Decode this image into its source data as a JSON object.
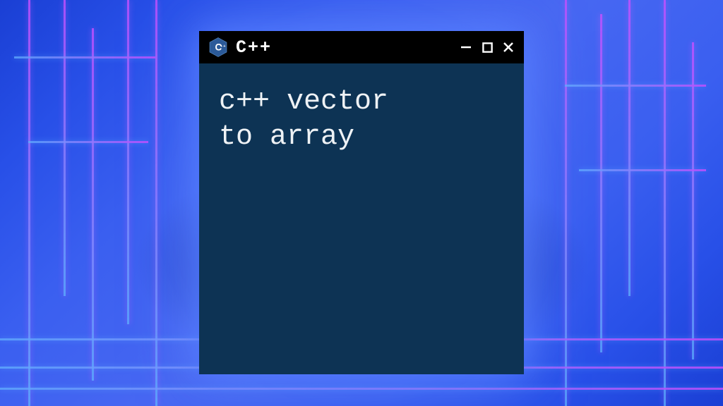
{
  "window": {
    "title": "C++",
    "logo_label": "C++",
    "content_line1": "c++ vector",
    "content_line2": "to array"
  },
  "colors": {
    "titlebar_bg": "#000000",
    "body_bg": "#0d3354",
    "text": "#eef2f5",
    "logo_fill": "#2b5a99",
    "logo_plus": "#ffffff"
  }
}
